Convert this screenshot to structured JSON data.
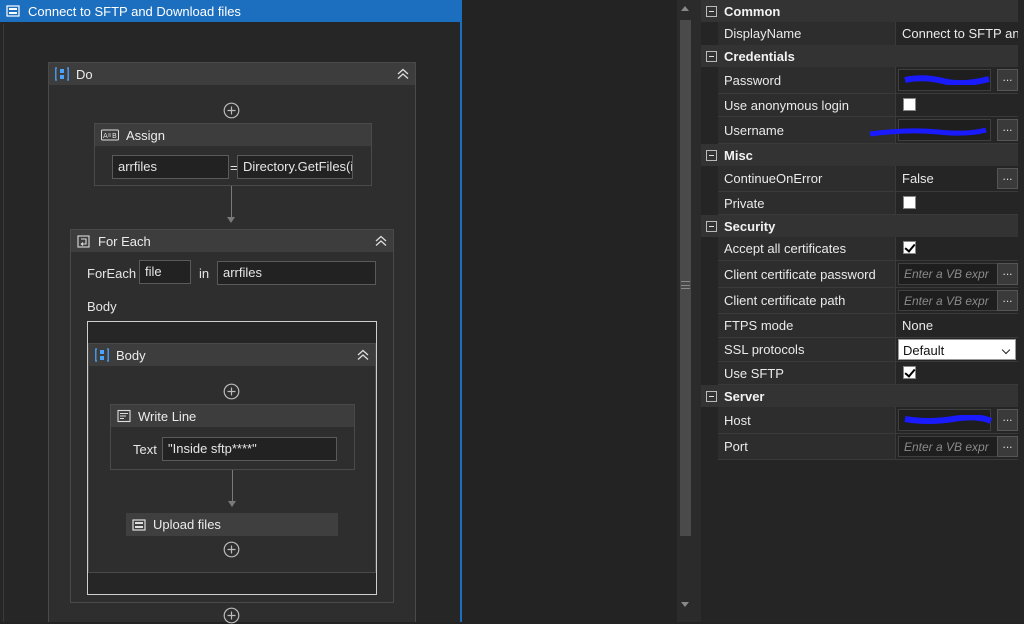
{
  "workflow": {
    "title": "Connect to SFTP and Download files",
    "do": {
      "label": "Do"
    },
    "assign": {
      "label": "Assign",
      "to": "arrfiles",
      "eq": "=",
      "value": "Directory.GetFiles(i"
    },
    "foreach": {
      "label": "For Each",
      "foreach_label": "ForEach",
      "item": "file",
      "in_label": "in",
      "collection": "arrfiles",
      "body_label": "Body"
    },
    "body": {
      "label": "Body"
    },
    "writeline": {
      "label": "Write Line",
      "text_label": "Text",
      "text_value": "\"Inside sftp****\""
    },
    "upload": {
      "label": "Upload files"
    }
  },
  "properties": {
    "categories": {
      "common": "Common",
      "credentials": "Credentials",
      "misc": "Misc",
      "security": "Security",
      "server": "Server"
    },
    "rows": {
      "display_name": {
        "name": "DisplayName",
        "value": "Connect to SFTP and"
      },
      "password": {
        "name": "Password"
      },
      "use_anonymous_login": {
        "name": "Use anonymous login",
        "checked": false
      },
      "username": {
        "name": "Username"
      },
      "continue_on_error": {
        "name": "ContinueOnError",
        "value": "False"
      },
      "private": {
        "name": "Private",
        "checked": false
      },
      "accept_all_certificates": {
        "name": "Accept all certificates",
        "checked": true
      },
      "client_certificate_password": {
        "name": "Client certificate password",
        "placeholder": "Enter a VB expr"
      },
      "client_certificate_path": {
        "name": "Client certificate path",
        "placeholder": "Enter a VB expr"
      },
      "ftps_mode": {
        "name": "FTPS mode",
        "value": "None"
      },
      "ssl_protocols": {
        "name": "SSL protocols",
        "value": "Default"
      },
      "use_sftp": {
        "name": "Use SFTP",
        "checked": true
      },
      "host": {
        "name": "Host"
      },
      "port": {
        "name": "Port",
        "placeholder": "Enter a VB expr"
      }
    },
    "ellipsis": "..."
  },
  "colors": {
    "accent": "#1c6fbf",
    "redaction": "#1a1aff"
  }
}
